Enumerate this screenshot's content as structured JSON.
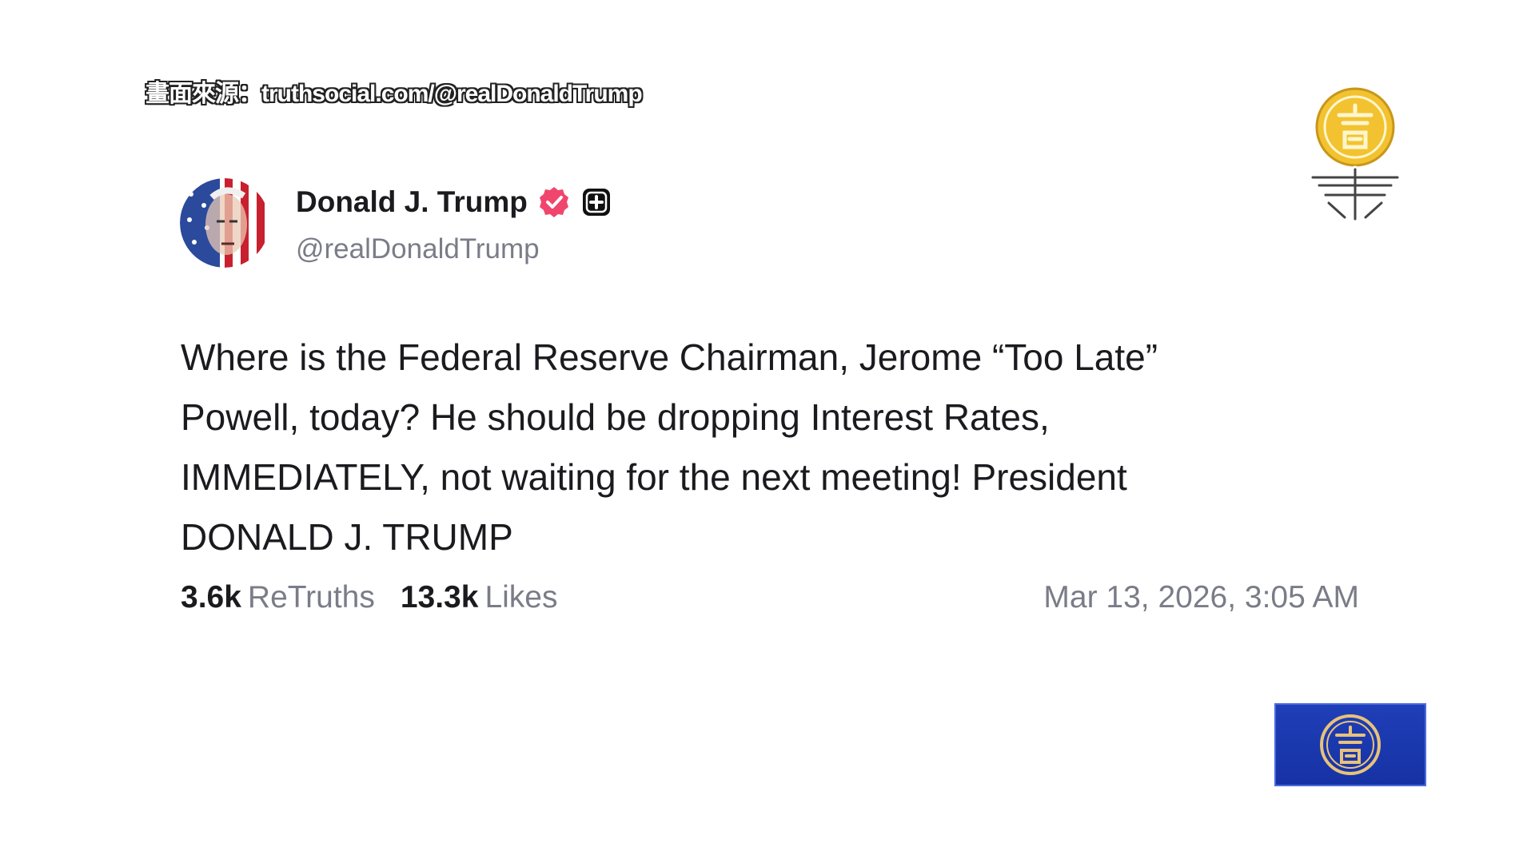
{
  "caption": {
    "source_text": "畫面來源：truthsocial.com/@realDonaldTrump"
  },
  "post": {
    "author": {
      "display_name": "Donald J. Trump",
      "handle": "@realDonaldTrump",
      "badges": [
        "verified-badge-icon",
        "plus-badge-icon"
      ]
    },
    "body_lines": [
      "Where is the Federal Reserve Chairman, Jerome “Too Late”",
      "Powell, today? He should be dropping Interest Rates,",
      "IMMEDIATELY, not waiting for the next meeting! President",
      "DONALD J. TRUMP"
    ],
    "stats": {
      "retruths_count": "3.6k",
      "retruths_label": "ReTruths",
      "likes_count": "13.3k",
      "likes_label": "Likes"
    },
    "timestamp": "Mar 13, 2026, 3:05 AM"
  },
  "branding": {
    "top_logo_icon": "ntd-gold-logo-icon",
    "bottom_logo_icon": "ntd-blue-box-logo-icon",
    "colors": {
      "verified": "#f0466e",
      "gold": "#f2c230",
      "box_blue": "#1a37ad"
    }
  }
}
